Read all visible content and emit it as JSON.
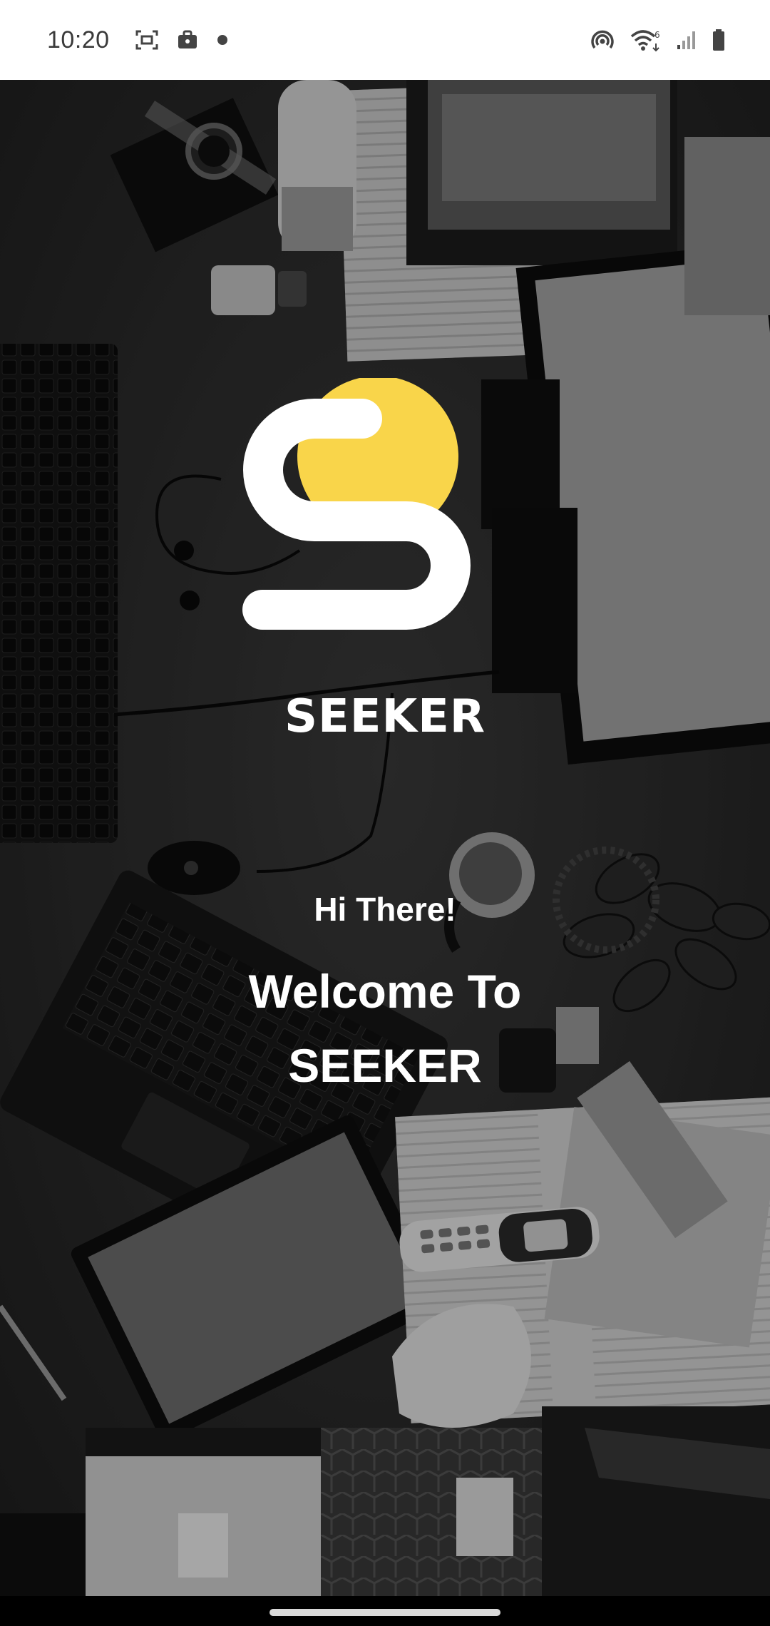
{
  "status_bar": {
    "time": "10:20",
    "left_icons": [
      "screenshot-icon",
      "briefcase-icon",
      "notification-dot-icon"
    ],
    "right_icons": [
      "hotspot-icon",
      "wifi-6-icon",
      "signal-icon",
      "battery-icon"
    ]
  },
  "splash": {
    "brand_name": "SEEKER",
    "greeting": "Hi There!",
    "welcome_line1": "Welcome To",
    "welcome_line2": "SEEKER"
  },
  "colors": {
    "logo_yellow": "#F9D54A",
    "logo_white": "#FFFFFF",
    "text": "#FFFFFF",
    "status_bar_bg": "#FFFFFF",
    "nav_bar_bg": "#000000"
  }
}
